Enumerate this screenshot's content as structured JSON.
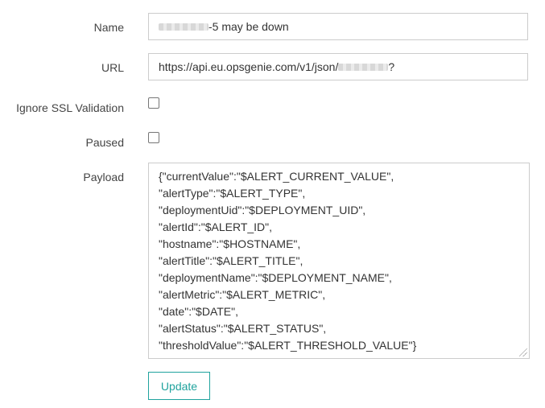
{
  "form": {
    "name": {
      "label": "Name",
      "value_suffix": "-5 may be down"
    },
    "url": {
      "label": "URL",
      "value_prefix": "https://api.eu.opsgenie.com/v1/json/",
      "value_suffix": "?"
    },
    "ignore_ssl": {
      "label": "Ignore SSL Validation",
      "checked": false
    },
    "paused": {
      "label": "Paused",
      "checked": false
    },
    "payload": {
      "label": "Payload",
      "lines": [
        "{\"currentValue\":\"$ALERT_CURRENT_VALUE\",",
        "\"alertType\":\"$ALERT_TYPE\",",
        "\"deploymentUid\":\"$DEPLOYMENT_UID\",",
        "\"alertId\":\"$ALERT_ID\",",
        "\"hostname\":\"$HOSTNAME\",",
        "\"alertTitle\":\"$ALERT_TITLE\",",
        "\"deploymentName\":\"$DEPLOYMENT_NAME\",",
        "\"alertMetric\":\"$ALERT_METRIC\",",
        "\"date\":\"$DATE\",",
        "\"alertStatus\":\"$ALERT_STATUS\",",
        "\"thresholdValue\":\"$ALERT_THRESHOLD_VALUE\"}"
      ]
    },
    "update_button": "Update"
  },
  "colors": {
    "accent": "#20a39e",
    "border": "#cccccc"
  }
}
